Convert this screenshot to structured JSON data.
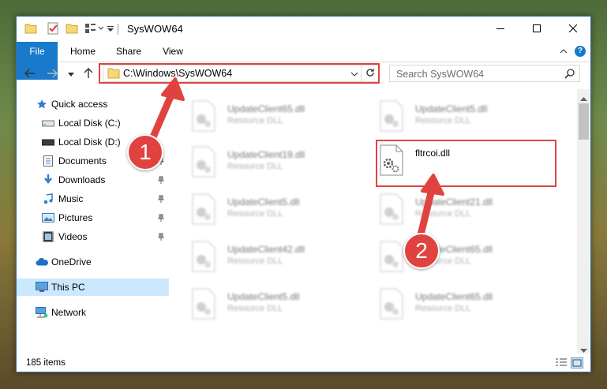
{
  "window": {
    "title": "SysWOW64",
    "controls": {
      "minimize": "minimize-icon",
      "maximize": "maximize-icon",
      "close": "close-icon"
    }
  },
  "ribbon": {
    "tabs": [
      "File",
      "Home",
      "Share",
      "View"
    ],
    "help": "?"
  },
  "address": {
    "path": "C:\\Windows\\SysWOW64",
    "search_placeholder": "Search SysWOW64"
  },
  "nav": {
    "items": [
      {
        "label": "Quick access",
        "icon": "star-icon"
      },
      {
        "label": "Local Disk (C:)",
        "icon": "drive-icon"
      },
      {
        "label": "Local Disk (D:)",
        "icon": "drive-icon"
      },
      {
        "label": "Documents",
        "icon": "documents-icon",
        "pinned": true
      },
      {
        "label": "Downloads",
        "icon": "downloads-icon",
        "pinned": true
      },
      {
        "label": "Music",
        "icon": "music-icon",
        "pinned": true
      },
      {
        "label": "Pictures",
        "icon": "pictures-icon",
        "pinned": true
      },
      {
        "label": "Videos",
        "icon": "videos-icon",
        "pinned": true
      },
      {
        "label": "OneDrive",
        "icon": "cloud-icon"
      },
      {
        "label": "This PC",
        "icon": "monitor-icon",
        "selected": true
      },
      {
        "label": "Network",
        "icon": "network-icon"
      }
    ]
  },
  "files": [
    {
      "name": "UpdateClient65.dll",
      "type": "Resource DLL",
      "blurred": true
    },
    {
      "name": "UpdateClient5.dll",
      "type": "Resource DLL",
      "blurred": true
    },
    {
      "name": "UpdateClient19.dll",
      "type": "Resource DLL",
      "blurred": true
    },
    {
      "name": "fltrcoi.dll",
      "type": "",
      "blurred": false
    },
    {
      "name": "UpdateClient5.dll",
      "type": "Resource DLL",
      "blurred": true
    },
    {
      "name": "UpdateClient21.dll",
      "type": "Resource DLL",
      "blurred": true
    },
    {
      "name": "UpdateClient42.dll",
      "type": "Resource DLL",
      "blurred": true
    },
    {
      "name": "UpdateClient65.dll",
      "type": "Resource DLL",
      "blurred": true
    },
    {
      "name": "UpdateClient5.dll",
      "type": "Resource DLL",
      "blurred": true
    },
    {
      "name": "UpdateClient65.dll",
      "type": "Resource DLL",
      "blurred": true
    }
  ],
  "status": {
    "items_count": "185 items"
  },
  "annotations": {
    "step1": "1",
    "step2": "2"
  },
  "colors": {
    "accent": "#1979ca",
    "annotation_red": "#e0433f",
    "selection": "#cce8ff"
  }
}
